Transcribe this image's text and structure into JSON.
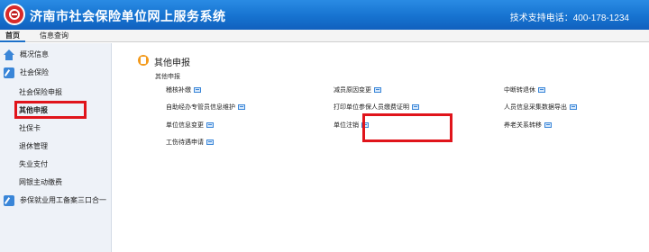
{
  "header": {
    "title": "济南市社会保险单位网上服务系统",
    "support": "技术支持电话：400-178-1234",
    "logo_icon": "social-insurance-logo-icon"
  },
  "topnav": {
    "tabs": [
      {
        "label": "首页",
        "active": true
      },
      {
        "label": "信息查询",
        "active": false
      }
    ]
  },
  "sidebar": {
    "items": [
      {
        "label": "概况信息",
        "icon": "home-icon"
      },
      {
        "label": "社会保险",
        "icon": "edit-icon"
      },
      {
        "label": "社会保险申报"
      },
      {
        "label": "其他申报",
        "active": true
      },
      {
        "label": "社保卡"
      },
      {
        "label": "退休管理"
      },
      {
        "label": "失业支付"
      },
      {
        "label": "网银主动缴费"
      },
      {
        "label": "参保就业用工备案三口合一",
        "icon": "edit-icon"
      }
    ]
  },
  "main": {
    "section_title": "其他申报",
    "section_subtitle": "其他申报",
    "links": [
      {
        "label": "稽核补缴"
      },
      {
        "label": "减员原因变更"
      },
      {
        "label": "中断转退休"
      },
      {
        "label": "自助经办专管员信息维护"
      },
      {
        "label": "打印单位参保人员缴费证明"
      },
      {
        "label": "人员信息采集数据导出"
      },
      {
        "label": "单位信息变更"
      },
      {
        "label": "单位注销"
      },
      {
        "label": "养老关系转移"
      },
      {
        "label": "工伤待遇申请"
      }
    ]
  },
  "colors": {
    "header_blue": "#1673d0",
    "highlight_red": "#e0141b",
    "sidebar_bg": "#eef2f8",
    "accent_orange": "#f39a1c"
  }
}
